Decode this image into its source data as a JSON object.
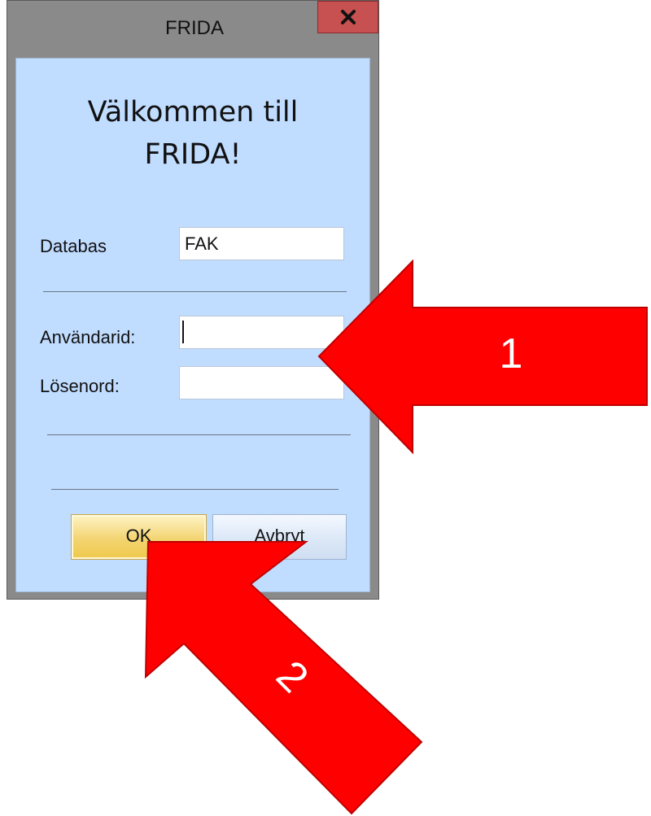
{
  "window": {
    "title": "FRIDA",
    "close_glyph": "x"
  },
  "dialog": {
    "welcome_line1": "Välkommen till",
    "welcome_line2": "FRIDA!",
    "database_label": "Databas",
    "database_value": "FAK",
    "userid_label": "Användarid:",
    "userid_value": "",
    "password_label": "Lösenord:",
    "password_value": "",
    "ok_label": "OK",
    "cancel_label": "Avbryt"
  },
  "annotations": {
    "arrow1_label": "1",
    "arrow2_label": "2",
    "arrow_color": "#ff0000"
  },
  "colors": {
    "dialog_background": "#c0dcff",
    "titlebar": "#8a8a8a",
    "close_button": "#c75050",
    "ok_button": "#f3d472"
  }
}
